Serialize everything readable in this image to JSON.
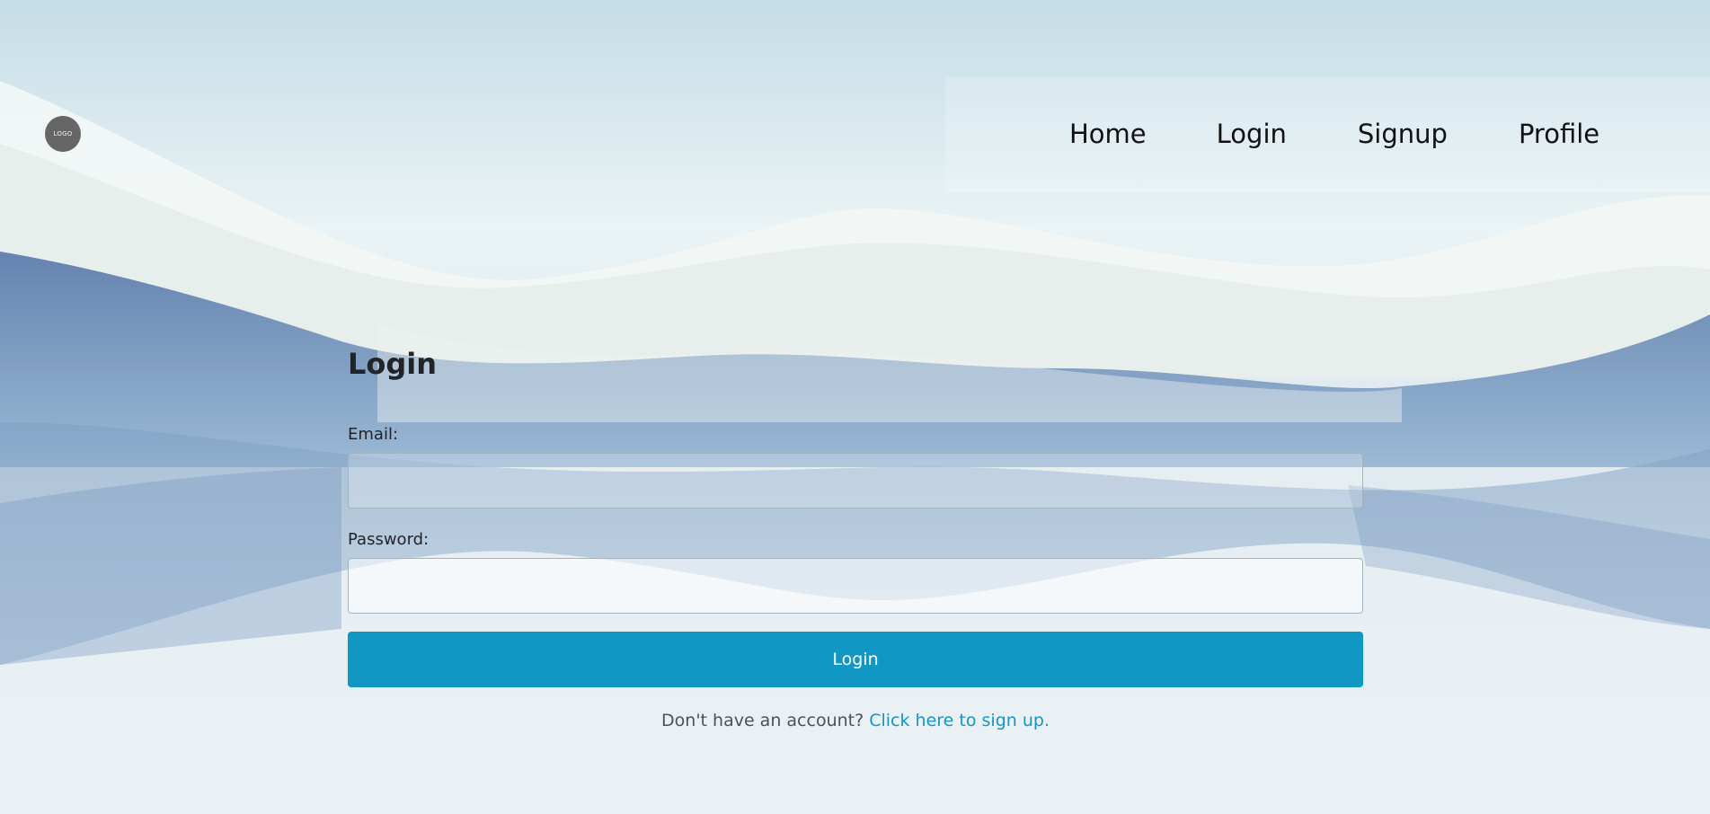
{
  "header": {
    "logo_text": "LOGO",
    "nav": {
      "home": "Home",
      "login": "Login",
      "signup": "Signup",
      "profile": "Profile"
    }
  },
  "login_form": {
    "title": "Login",
    "email_label": "Email:",
    "email_value": "",
    "password_label": "Password:",
    "password_value": "",
    "submit_label": "Login",
    "signup_prompt": "Don't have an account?",
    "signup_link": "Click here to sign up."
  },
  "colors": {
    "primary_button": "#1097c3",
    "link": "#1794c6",
    "logo_bg": "#666666"
  }
}
